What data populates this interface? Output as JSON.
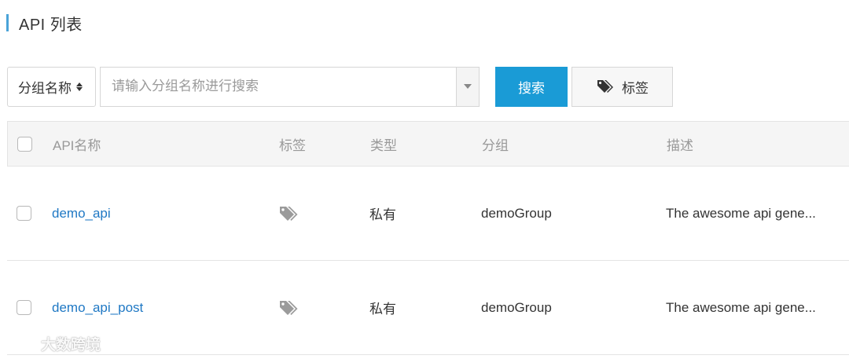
{
  "page": {
    "title": "API 列表"
  },
  "toolbar": {
    "filter_select": {
      "selected": "分组名称"
    },
    "search": {
      "placeholder": "请输入分组名称进行搜索",
      "value": ""
    },
    "search_button_label": "搜索",
    "tag_button_label": "标签"
  },
  "table": {
    "headers": {
      "name": "API名称",
      "tag": "标签",
      "type": "类型",
      "group": "分组",
      "description": "描述"
    },
    "rows": [
      {
        "name": "demo_api",
        "tag_icon": "tags-icon",
        "type": "私有",
        "group": "demoGroup",
        "description": "The awesome api gene..."
      },
      {
        "name": "demo_api_post",
        "tag_icon": "tags-icon",
        "type": "私有",
        "group": "demoGroup",
        "description": "The awesome api gene..."
      }
    ]
  },
  "watermark": {
    "text": "大数跨境"
  },
  "colors": {
    "accent": "#1a9bd6",
    "link": "#1f78c4",
    "title_bar": "#4aa3d8",
    "header_bg": "#f5f5f5",
    "icon_gray": "#9b9b9b"
  }
}
